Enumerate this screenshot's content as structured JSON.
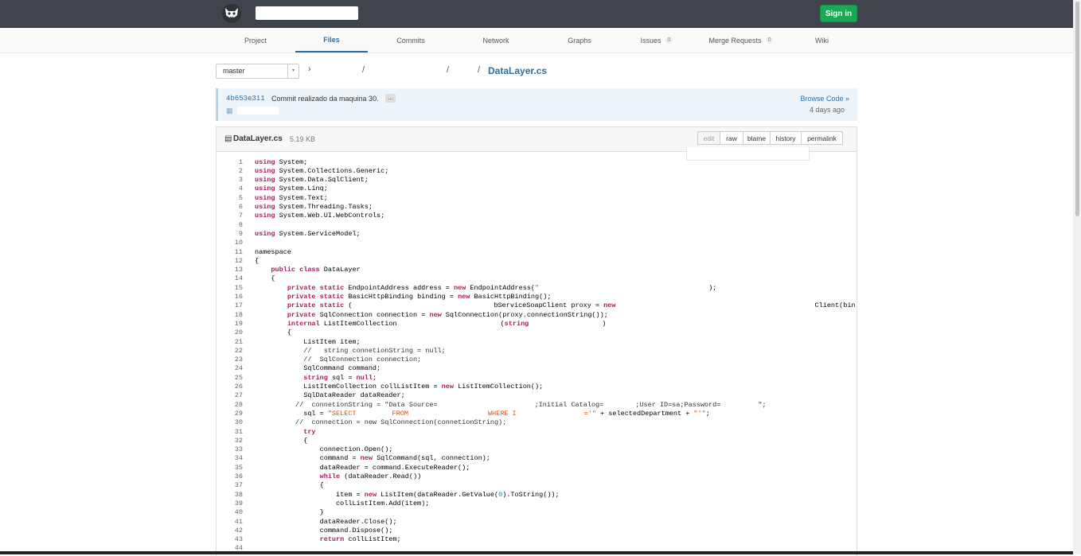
{
  "header": {
    "sign_in": "Sign in"
  },
  "nav": {
    "project": "Project",
    "files": "Files",
    "commits": "Commits",
    "network": "Network",
    "graphs": "Graphs",
    "issues": "Issues",
    "issues_count": "0",
    "merge_requests": "Merge Requests",
    "merge_requests_count": "0",
    "wiki": "Wiki"
  },
  "breadcrumb": {
    "branch": "master",
    "sep1": "›",
    "sep2": "/",
    "sep3": "/",
    "sep4": "/",
    "file": "DataLayer.cs"
  },
  "commit": {
    "sha": "4b653e311",
    "message": "Commit realizado da maquina 30.",
    "ellipsis": "...",
    "browse": "Browse Code »",
    "time": "4 days ago"
  },
  "file": {
    "name": "DataLayer.cs",
    "size": "5.19 KB",
    "buttons": {
      "edit": "edit",
      "raw": "raw",
      "blame": "blame",
      "history": "history",
      "permalink": "permalink"
    }
  },
  "code_lines": [
    "1",
    "2",
    "3",
    "4",
    "5",
    "6",
    "7",
    "8",
    "9",
    "10",
    "11",
    "12",
    "13",
    "14",
    "15",
    "16",
    "17",
    "18",
    "19",
    "20",
    "21",
    "22",
    "23",
    "24",
    "25",
    "26",
    "27",
    "28",
    "29",
    "30",
    "31",
    "32",
    "33",
    "34",
    "35",
    "36",
    "37",
    "38",
    "39",
    "40",
    "41",
    "42",
    "43",
    "44"
  ],
  "code_text": {
    "l1": "System;",
    "l2": "System.Collections.Generic;",
    "l3": "System.Data.SqlClient;",
    "l4": "System.Linq;",
    "l5": "System.Text;",
    "l6": "System.Threading.Tasks;",
    "l7": "System.Web.UI.WebControls;",
    "l9": "System.ServiceModel;",
    "l11": "namespace",
    "l12": "{",
    "l13": "DataLayer",
    "l14": "    {",
    "l15a": "EndpointAddress address = ",
    "l15b": "EndpointAddress(",
    "l15c": "\"",
    "l15d": ");",
    "l16a": "BasicHttpBinding binding = ",
    "l16b": "BasicHttpBinding();",
    "l17a": "(",
    "l17b": "bServiceSoapClient proxy = ",
    "l17c": "Client(bin",
    "l18a": "SqlConnection connection = ",
    "l18b": "SqlConnection(proxy.connectionString());",
    "l19a": "ListItemCollection",
    "l19b": "(",
    "l19c": ")",
    "l20": "{",
    "l21": "ListItem item;",
    "l22": "//   string connetionString = null;",
    "l23": "//  SqlConnection connection;",
    "l24": "SqlCommand command;",
    "l25": "sql = ",
    "l25b": ";",
    "l26a": "ListItemCollection collListItem = ",
    "l26b": "ListItemCollection();",
    "l27": "SqlDataReader dataReader;",
    "l28a": "//  connetionString = \"Data Source=",
    "l28b": ";Initial Catalog=",
    "l28c": ";User ID=sa;Password=",
    "l28d": "\";",
    "l29a": "sql = ",
    "l29b": "\"SELECT",
    "l29c": "FROM",
    "l29d": "WHERE I",
    "l29e": "='\"",
    "l29f": " + selectedDepartment + ",
    "l29g": "\"'\"",
    "l29h": ";",
    "l30": "//  connection = new SqlConnection(connetionString);",
    "l32": "{",
    "l33": "connection.Open();",
    "l34a": "command = ",
    "l34b": "SqlCommand(sql, connection);",
    "l35": "dataReader = command.ExecuteReader();",
    "l36": "(dataReader.Read())",
    "l37": "{",
    "l38a": "item = ",
    "l38b": "ListItem(dataReader.GetValue(",
    "l38c": "0",
    "l38d": ").ToString());",
    "l39": "collListItem.Add(item);",
    "l40": "}",
    "l41": "dataReader.Close();",
    "l42": "command.Dispose();",
    "l43": "collListItem;"
  },
  "keywords": {
    "using": "using",
    "public": "public",
    "class": "class",
    "private": "private",
    "static": "static",
    "new": "new",
    "internal": "internal",
    "string": "string",
    "null": "null",
    "try": "try",
    "while": "while",
    "return": "return"
  }
}
